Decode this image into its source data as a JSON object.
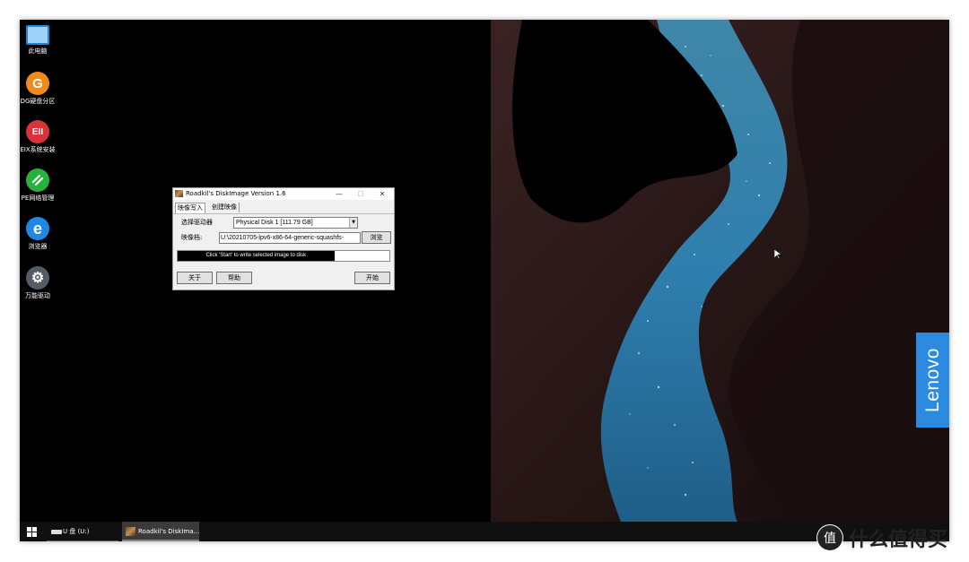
{
  "desktop": {
    "icons": [
      {
        "label": "此电脑",
        "glyph": "",
        "color": "#1f86d6"
      },
      {
        "label": "DG硬盘分区",
        "glyph": "G",
        "color": "#f18a1d"
      },
      {
        "label": "EIX系统安装",
        "glyph": "EII",
        "color": "#d9323a"
      },
      {
        "label": "PE网络管理",
        "glyph": "",
        "color": "#26b23c"
      },
      {
        "label": "浏览器",
        "glyph": "e",
        "color": "#1e88e5"
      },
      {
        "label": "万能驱动",
        "glyph": "⚙",
        "color": "#555b66"
      }
    ],
    "brand_badge": "Lenovo",
    "brand_color": "#2b8be0"
  },
  "window": {
    "title": "Roadkil's DiskImage Version 1.6",
    "minimize": "—",
    "maximize": "☐",
    "close": "✕",
    "tabs": [
      "映像写入",
      "创建映像"
    ],
    "active_tab": "映像写入",
    "drive_label": "选择驱动器",
    "drive_value": "Physical Disk 1 [111.79 GB]",
    "image_label": "映像档:",
    "image_value": "U:\\20210705-lpv6-x86-64-generic-squashfs-",
    "browse_label": "浏览",
    "progress_text": "Click 'Start' to write selected image to disk",
    "progress_fraction": 0.74,
    "about_label": "关于",
    "help_label": "帮助",
    "start_label": "开始"
  },
  "taskbar": {
    "drive_item": "U 盘 (U:)",
    "app_item": "Roadkil's DiskIma..."
  },
  "watermark": {
    "text": "什么值得买",
    "logo_glyph": "值"
  }
}
